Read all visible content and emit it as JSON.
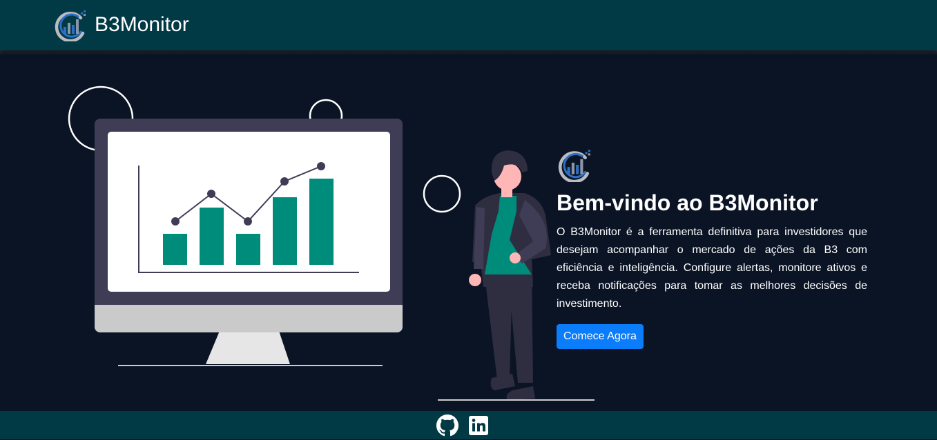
{
  "navbar": {
    "brand_name": "B3Monitor",
    "logo_icon": "b3monitor-logo-icon"
  },
  "hero": {
    "logo_icon": "b3monitor-logo-icon",
    "title": "Bem-vindo ao B3Monitor",
    "description": "O B3Monitor é a ferramenta definitiva para investidores que desejam acompanhar o mercado de ações da B3 com eficiência e inteligência. Configure alertas, monitore ativos e receba notificações para tomar as melhores decisões de investimento.",
    "cta_label": "Comece Agora"
  },
  "illustration": {
    "icon": "monitor-chart-person-illustration"
  },
  "footer": {
    "links": [
      {
        "icon": "github-icon"
      },
      {
        "icon": "linkedin-icon"
      }
    ]
  },
  "colors": {
    "navbar_bg": "#013a45",
    "page_bg": "#0b1425",
    "chart_bar": "#008c7a",
    "accent_button": "#0b7dfa",
    "shirt": "#008c7a"
  }
}
